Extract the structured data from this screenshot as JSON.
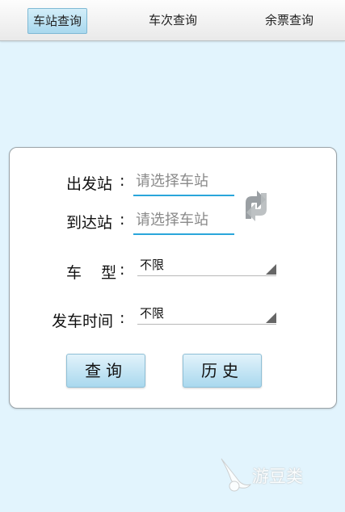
{
  "tabs": [
    {
      "label": "车站查询",
      "active": true
    },
    {
      "label": "车次查询",
      "active": false
    },
    {
      "label": "余票查询",
      "active": false
    }
  ],
  "form": {
    "departure": {
      "label": "出发站",
      "placeholder": "请选择车站"
    },
    "arrival": {
      "label": "到达站",
      "placeholder": "请选择车站"
    },
    "train_type": {
      "label": "车    型",
      "value": "不限"
    },
    "depart_time": {
      "label": "发车时间",
      "value": "不限"
    },
    "colon": ":"
  },
  "buttons": {
    "query": "查询",
    "history": "历史"
  },
  "watermark": {
    "text": "游豆类"
  },
  "colors": {
    "background": "#e2f4fd",
    "accent": "#2aa6db",
    "swap_icon": "#9a9fa3",
    "button_top": "#e2f3fb",
    "button_bottom": "#a9d8ee"
  },
  "icons": {
    "swap": "swap-arrows-icon",
    "dropdown": "dropdown-triangle-icon",
    "watermark": "bird-logo-icon"
  }
}
